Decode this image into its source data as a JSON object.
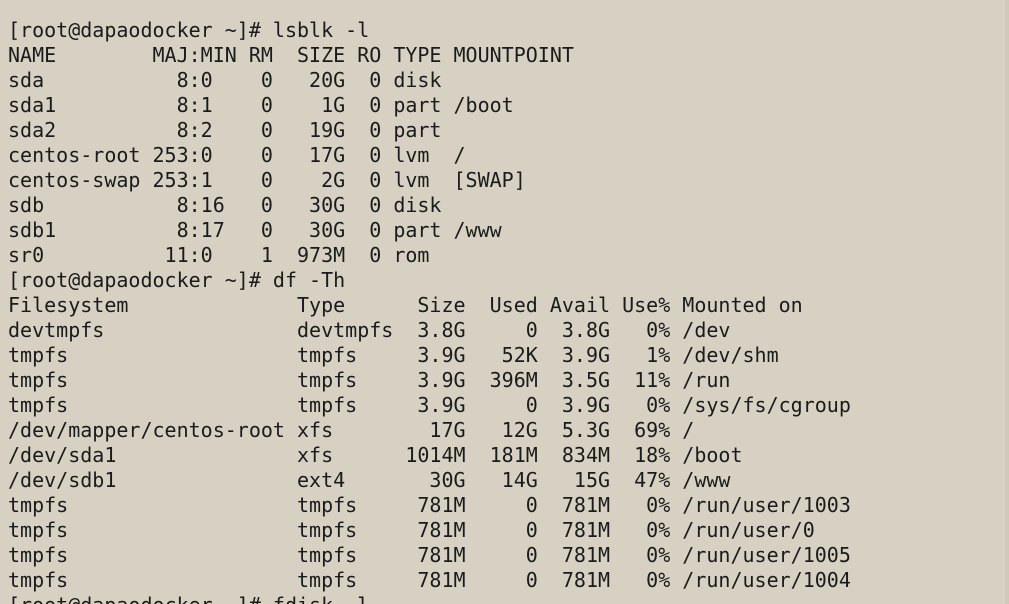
{
  "terminal": {
    "lines": [
      "[root@dapaodocker ~]# lsblk -l",
      "NAME        MAJ:MIN RM  SIZE RO TYPE MOUNTPOINT",
      "sda           8:0    0   20G  0 disk",
      "sda1          8:1    0    1G  0 part /boot",
      "sda2          8:2    0   19G  0 part",
      "centos-root 253:0    0   17G  0 lvm  /",
      "centos-swap 253:1    0    2G  0 lvm  [SWAP]",
      "sdb           8:16   0   30G  0 disk",
      "sdb1          8:17   0   30G  0 part /www",
      "sr0          11:0    1  973M  0 rom",
      "[root@dapaodocker ~]# df -Th",
      "Filesystem              Type      Size  Used Avail Use% Mounted on",
      "devtmpfs                devtmpfs  3.8G     0  3.8G   0% /dev",
      "tmpfs                   tmpfs     3.9G   52K  3.9G   1% /dev/shm",
      "tmpfs                   tmpfs     3.9G  396M  3.5G  11% /run",
      "tmpfs                   tmpfs     3.9G     0  3.9G   0% /sys/fs/cgroup",
      "/dev/mapper/centos-root xfs        17G   12G  5.3G  69% /",
      "/dev/sda1               xfs      1014M  181M  834M  18% /boot",
      "/dev/sdb1               ext4       30G   14G   15G  47% /www",
      "tmpfs                   tmpfs     781M     0  781M   0% /run/user/1003",
      "tmpfs                   tmpfs     781M     0  781M   0% /run/user/0",
      "tmpfs                   tmpfs     781M     0  781M   0% /run/user/1005",
      "tmpfs                   tmpfs     781M     0  781M   0% /run/user/1004",
      "[root@dapaodocker ~]# fdisk -l"
    ]
  }
}
